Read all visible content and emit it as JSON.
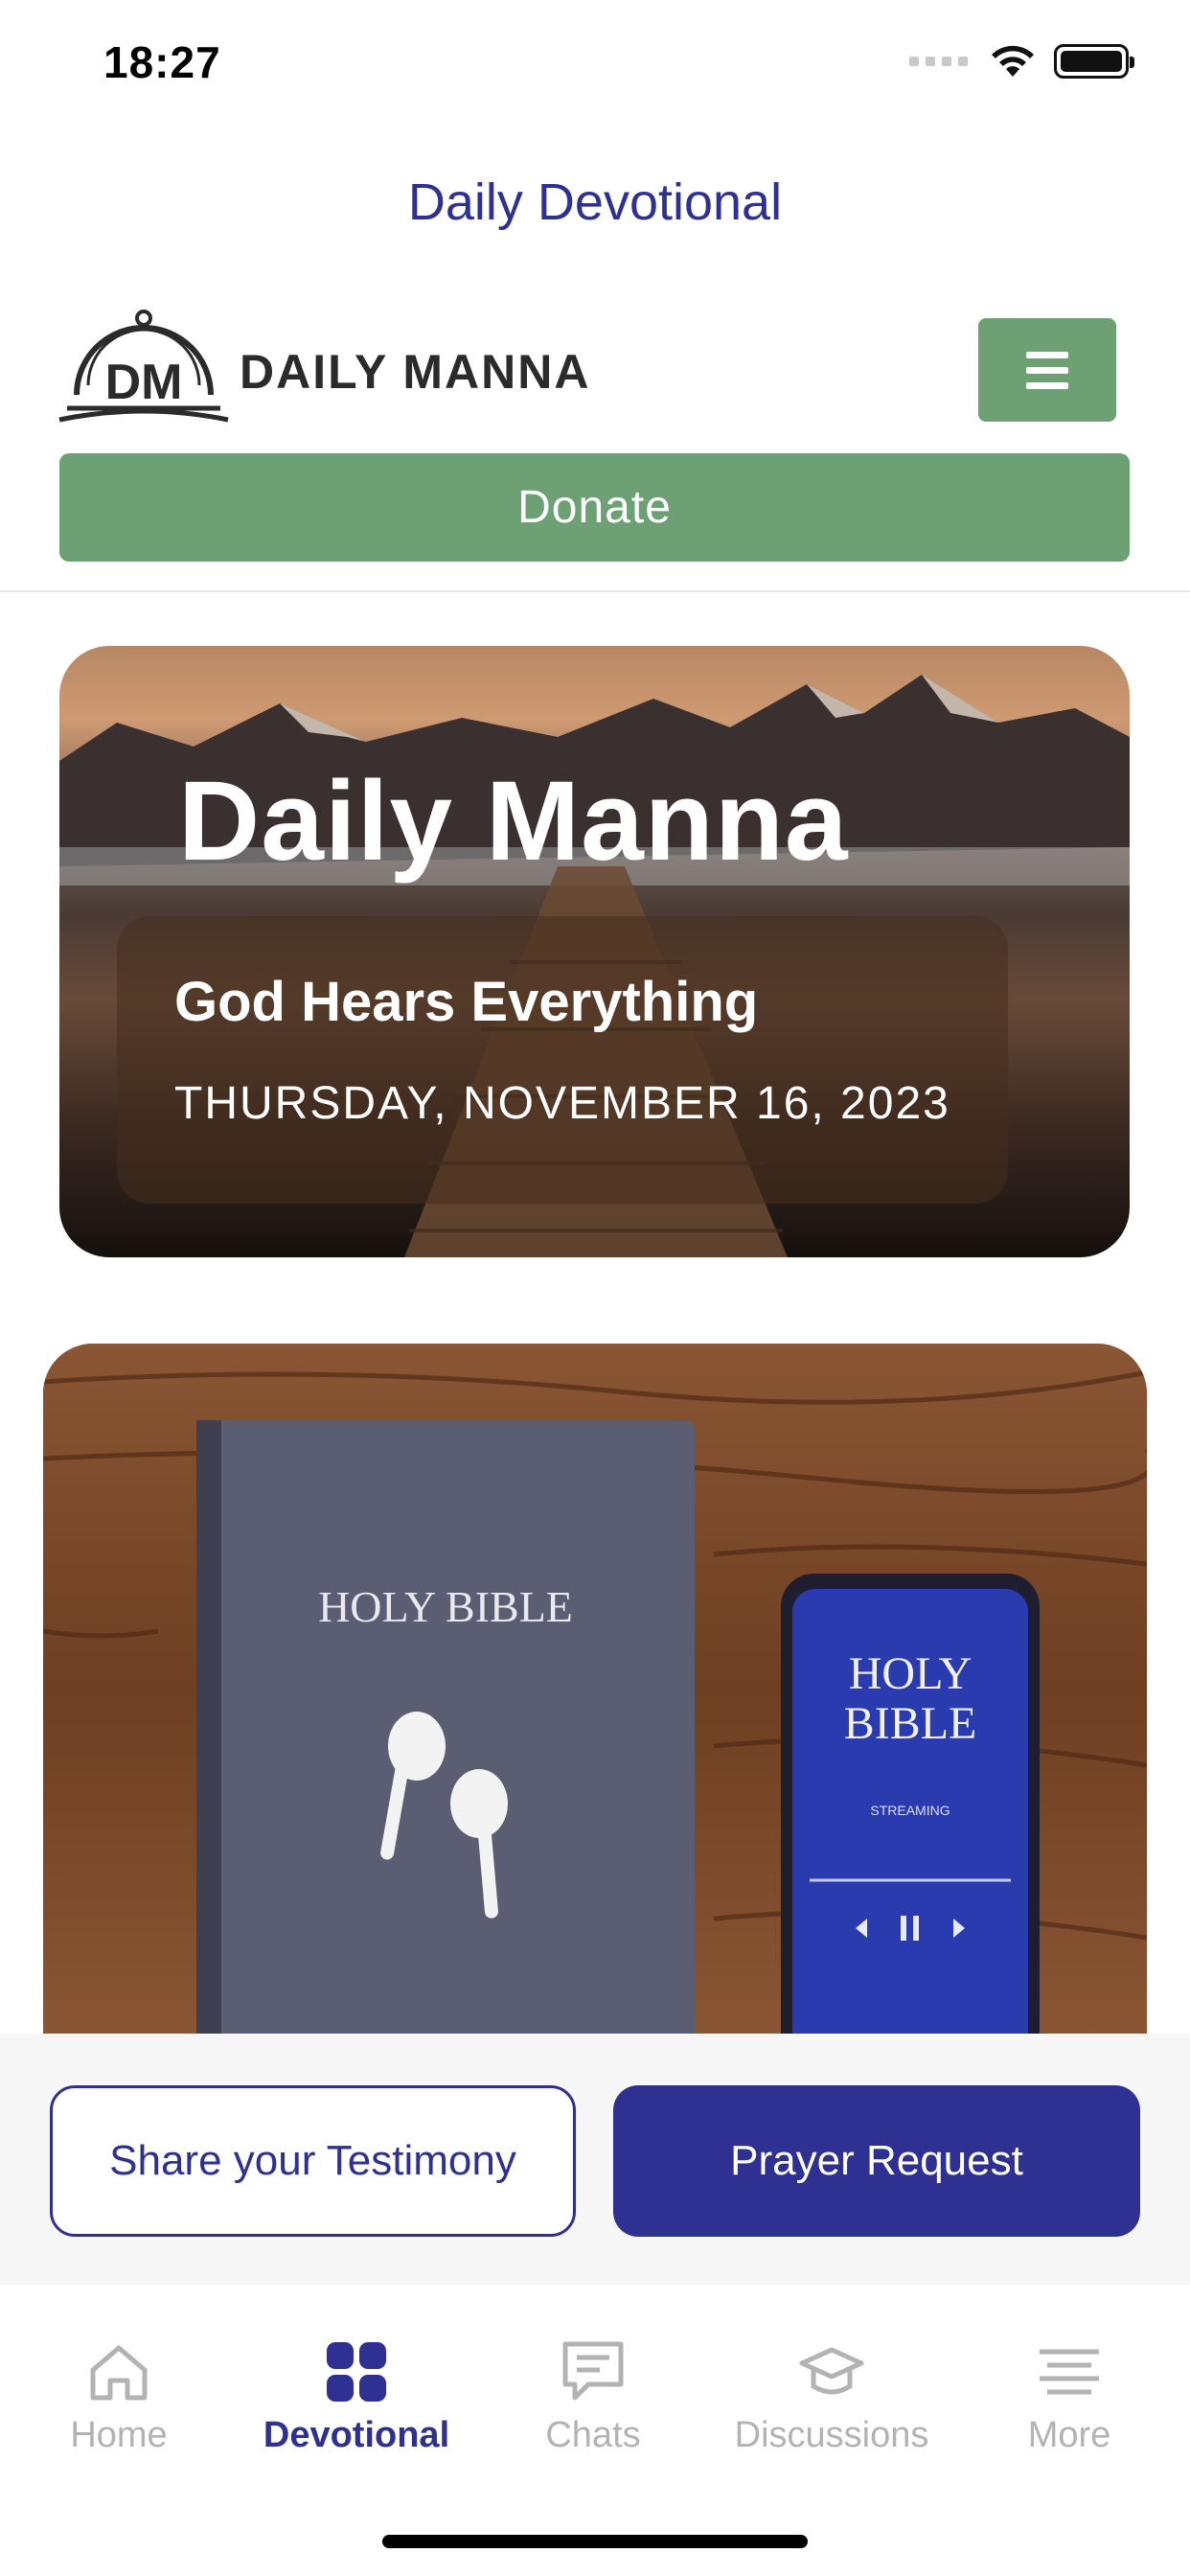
{
  "status_bar": {
    "time": "18:27"
  },
  "header": {
    "title": "Daily Devotional",
    "logo_text": "DAILY MANNA",
    "logo_mark_text": "DM",
    "donate_label": "Donate"
  },
  "hero": {
    "title": "Daily Manna",
    "subtitle": "God Hears Everything",
    "date": "THURSDAY, NOVEMBER 16, 2023"
  },
  "bible_card": {
    "book_text": "HOLY BIBLE",
    "phone_text_line1": "HOLY",
    "phone_text_line2": "BIBLE",
    "phone_status": "STREAMING"
  },
  "actions": {
    "testimony_label": "Share your Testimony",
    "prayer_label": "Prayer Request"
  },
  "tabs": [
    {
      "label": "Home",
      "icon": "home-icon",
      "active": false
    },
    {
      "label": "Devotional",
      "icon": "grid-icon",
      "active": true
    },
    {
      "label": "Chats",
      "icon": "chat-icon",
      "active": false
    },
    {
      "label": "Discussions",
      "icon": "graduation-cap-icon",
      "active": false
    },
    {
      "label": "More",
      "icon": "menu-lines-icon",
      "active": false
    }
  ],
  "colors": {
    "primary": "#2e3192",
    "green": "#6da173",
    "inactive": "#b3b3b3"
  }
}
